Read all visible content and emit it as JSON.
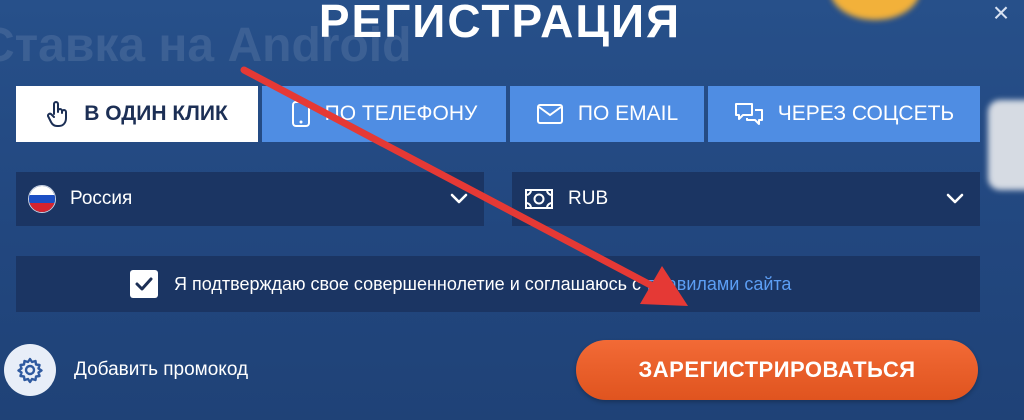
{
  "modal": {
    "title": "РЕГИСТРАЦИЯ",
    "close_glyph": "×"
  },
  "background_text": {
    "heading": "Ставка на Android",
    "line1": "……………………………………",
    "line2": "……………………………………………………"
  },
  "tabs": [
    {
      "label": "В ОДИН КЛИК",
      "icon": "hand-pointer-icon",
      "active": true
    },
    {
      "label": "ПО ТЕЛЕФОНУ",
      "icon": "phone-icon",
      "active": false
    },
    {
      "label": "ПО EMAIL",
      "icon": "envelope-icon",
      "active": false
    },
    {
      "label": "ЧЕРЕЗ СОЦСЕТЬ",
      "icon": "chat-bubbles-icon",
      "active": false
    }
  ],
  "country_select": {
    "value": "Россия",
    "icon": "russia-flag-icon"
  },
  "currency_select": {
    "value": "RUB",
    "icon": "banknote-icon"
  },
  "agreement": {
    "checked": true,
    "text": "Я подтверждаю свое совершеннолетие и соглашаюсь с",
    "link_text": "правилами сайта"
  },
  "promo": {
    "label": "Добавить промокод",
    "icon": "gear-icon"
  },
  "register_button": {
    "label": "ЗАРЕГИСТРИРОВАТЬСЯ"
  },
  "colors": {
    "background": "#24487f",
    "tab_inactive": "#4f8de3",
    "tab_active": "#ffffff",
    "field_bg": "#1b3563",
    "link": "#5c9ef4",
    "register": "#e85d28",
    "annotation_arrow": "#e53935"
  }
}
